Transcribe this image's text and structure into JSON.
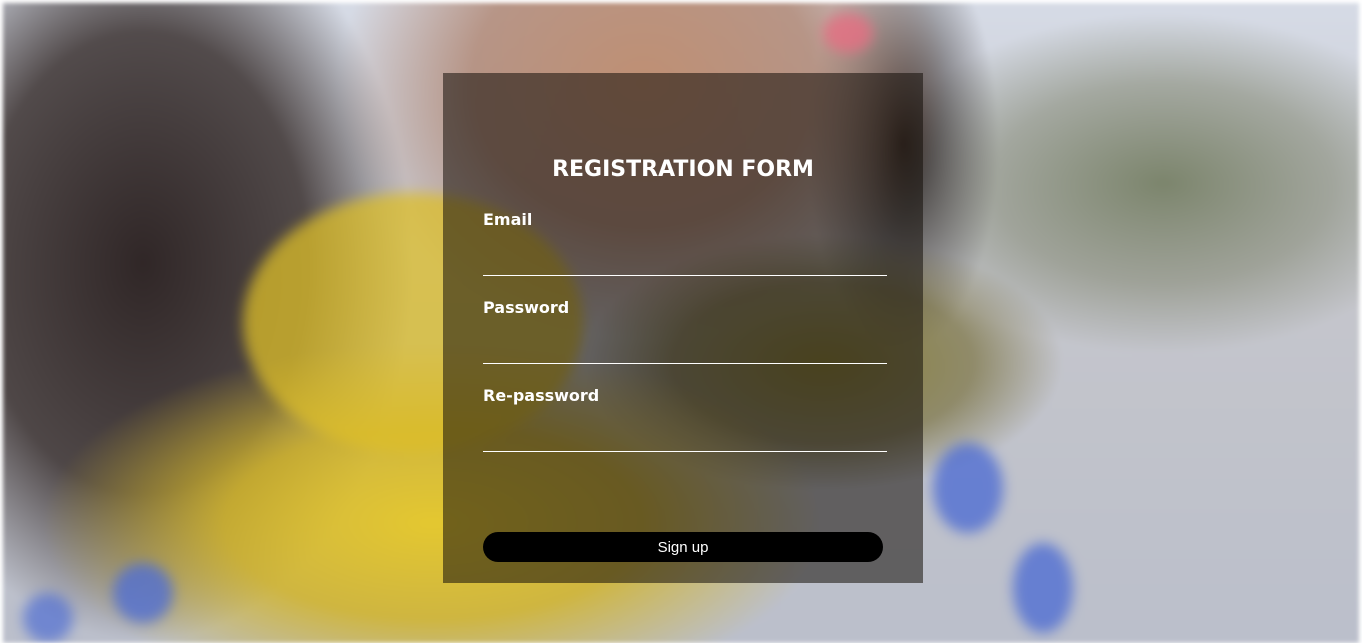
{
  "form": {
    "title": "REGISTRATION FORM",
    "fields": [
      {
        "label": "Email",
        "value": "",
        "placeholder": ""
      },
      {
        "label": "Password",
        "value": "",
        "placeholder": ""
      },
      {
        "label": "Re-password",
        "value": "",
        "placeholder": ""
      }
    ],
    "submit_label": "Sign up"
  },
  "colors": {
    "panel_overlay": "#140f0a",
    "text": "#ffffff",
    "button_bg": "#000000"
  }
}
